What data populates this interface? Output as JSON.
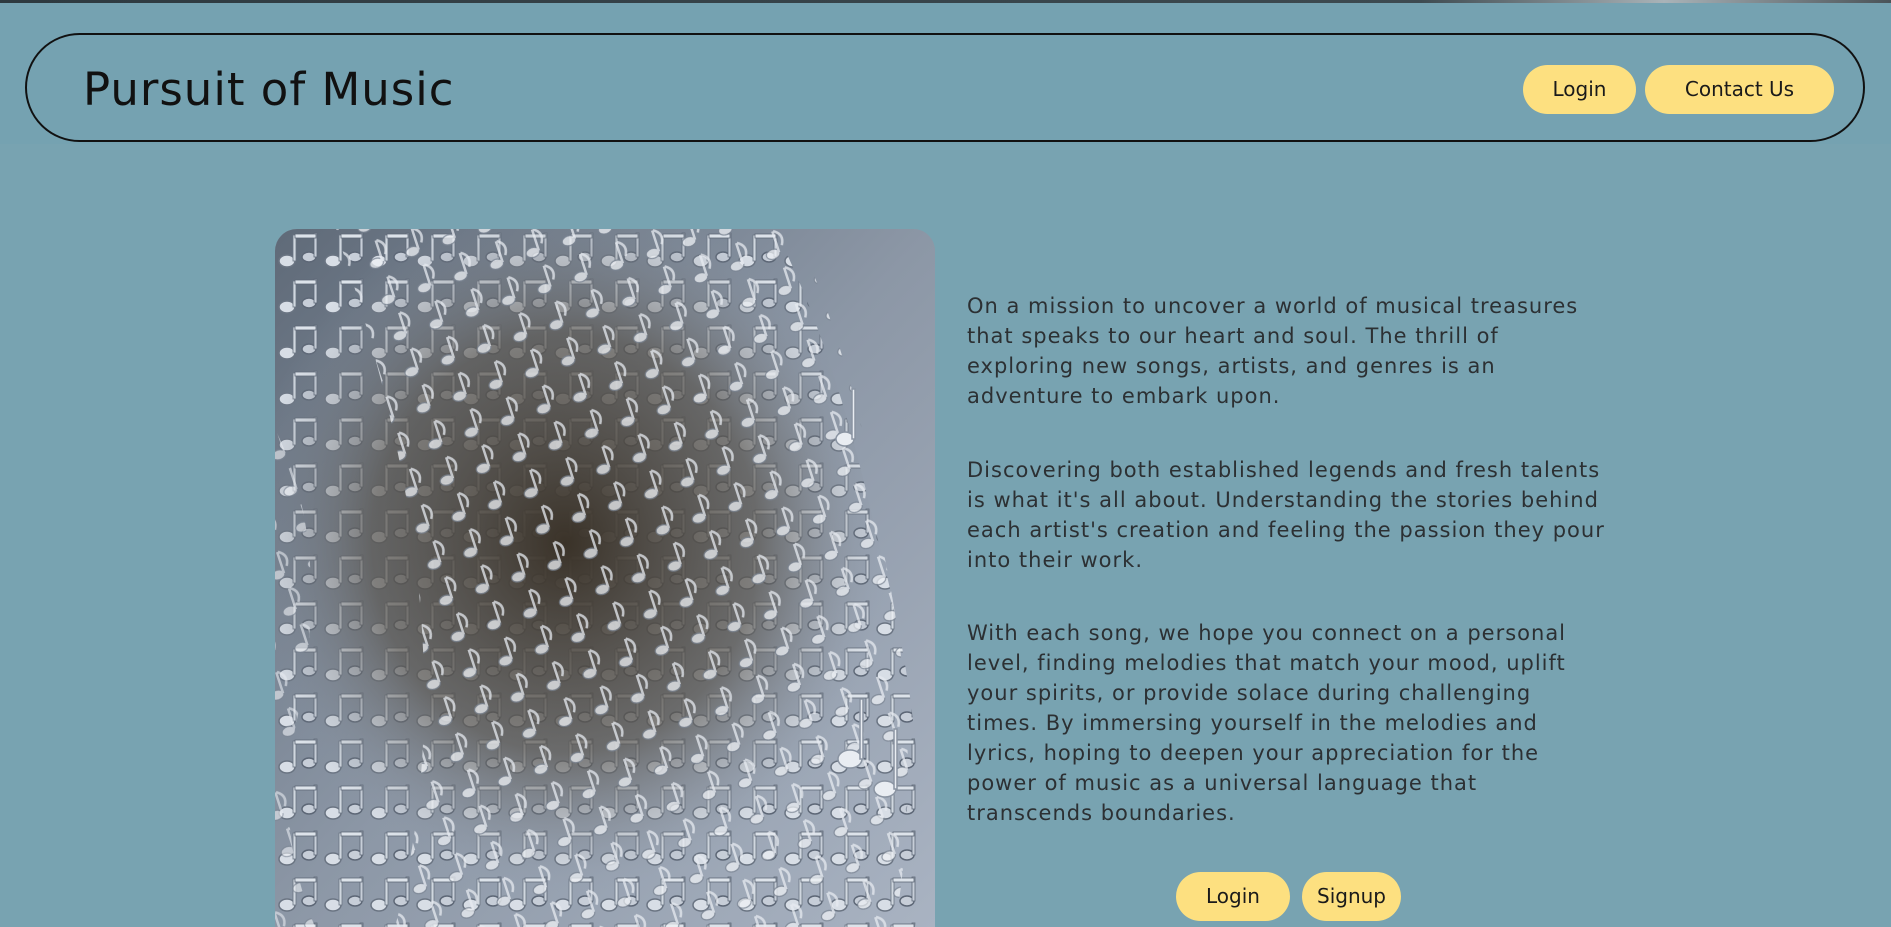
{
  "header": {
    "brand": "Pursuit of Music",
    "nav": {
      "login_label": "Login",
      "contact_label": "Contact Us"
    }
  },
  "hero": {
    "image_icon": "music-notes-sculpture",
    "paragraphs": [
      "On a mission to uncover a world of musical treasures that speaks to our heart and soul. The thrill of exploring new songs, artists, and genres is an adventure to embark upon.",
      "Discovering both established legends and fresh talents is what it's all about. Understanding the stories behind each artist's creation and feeling the passion they pour into their work.",
      "With each song, we hope you connect on a personal level, finding melodies that match your mood, uplift your spirits, or provide solace during challenging times. By immersing yourself in the melodies and lyrics, hoping to deepen your appreciation for the power of music as a universal language that transcends boundaries."
    ],
    "cta": {
      "login_label": "Login",
      "signup_label": "Signup"
    }
  },
  "colors": {
    "background": "#78a3b1",
    "button": "#fde080",
    "text": "#2c3033"
  }
}
